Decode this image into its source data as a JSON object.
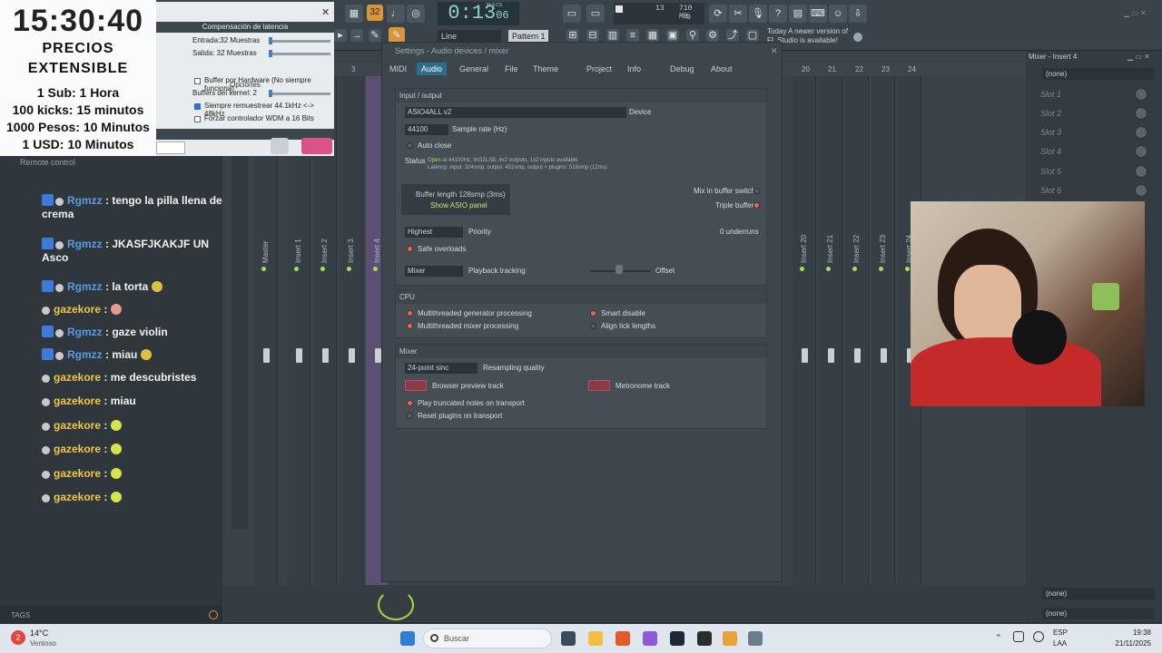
{
  "overlay": {
    "clock": "15:30:40",
    "title1": "PRECIOS",
    "title2": "EXTENSIBLE",
    "lines": [
      "1 Sub: 1 Hora",
      "100 kicks: 15 minutos",
      "1000 Pesos: 10 Minutos",
      "1 USD: 10 Minutos"
    ]
  },
  "toolbar": {
    "tempo": "32",
    "time": "0:13",
    "time_small": "06",
    "time_unit": "M:S:CS",
    "cpu_value": "13",
    "ram_value": "710 MB",
    "poly_value": "0",
    "line_label": "Line",
    "pattern_label": "Pattern 1",
    "news_line1": "Today  A newer version of",
    "news_line2": "FL Studio is available!"
  },
  "latency": {
    "header": "Compensación de latencia",
    "entrada": "Entrada:32 Muestras",
    "salida": "Salida:  32 Muestras",
    "opciones": "Opciones",
    "buffer_hw": "Buffer por Hardware (No siempre funciona)",
    "buffers_kernel": "Buffers del kernel: 2",
    "remuestrear": "Siempre remuestrear 44.1kHz <-> 48kHz",
    "forzar": "Forzar controlador WDM a 16 Bits"
  },
  "chat": {
    "remote": "Remote control",
    "messages": [
      {
        "user": "Rgmzz",
        "text": ": tengo la pilla llena de crema"
      },
      {
        "user": "Rgmzz",
        "text": ": JKASFJKAKJF UN Asco"
      },
      {
        "user": "Rgmzz",
        "text": ": la torta"
      },
      {
        "user": "gazekore",
        "text": ":"
      },
      {
        "user": "Rgmzz",
        "text": ": gaze violin"
      },
      {
        "user": "Rgmzz",
        "text": ": miau"
      },
      {
        "user": "gazekore",
        "text": ": me descubristes"
      },
      {
        "user": "gazekore",
        "text": ": miau"
      },
      {
        "user": "gazekore",
        "text": ":"
      },
      {
        "user": "gazekore",
        "text": ":"
      },
      {
        "user": "gazekore",
        "text": ":"
      },
      {
        "user": "gazekore",
        "text": ":"
      }
    ],
    "tags": "TAGS"
  },
  "mixer": {
    "strips": [
      "Master",
      "Insert 1",
      "Insert 2",
      "Insert 3",
      "Insert 4",
      "Insert 20",
      "Insert 21",
      "Insert 22",
      "Insert 23",
      "Insert 24"
    ],
    "numbers": [
      "3",
      "20",
      "21",
      "22",
      "23",
      "24"
    ]
  },
  "settings": {
    "title": "Settings - Audio devices / mixer",
    "tabs": [
      "MIDI",
      "Audio",
      "General",
      "File",
      "Theme",
      "Project",
      "Info",
      "Debug",
      "About"
    ],
    "io_header": "Input / output",
    "device_value": "ASIO4ALL v2",
    "device_label": "Device",
    "rate_value": "44100",
    "rate_label": "Sample rate (Hz)",
    "auto_close": "Auto close",
    "status_label": "Status",
    "status_open": "Open",
    "status_line1": "at 44100Hz, Int32LSB, 4x2 outputs, 1x2 inputs available",
    "status_line2": "Latency: input: 324smp, output: 452smp, output + plugins: 516smp (12ms)",
    "buffer_length": "Buffer length 128smp (3ms)",
    "show_asio": "Show ASIO panel",
    "mix_buffer": "Mix in buffer switch",
    "triple_buffer": "Triple buffer",
    "priority_value": "Highest",
    "priority_label": "Priority",
    "underruns": "0 underruns",
    "safe_overloads": "Safe overloads",
    "playback_value": "Mixer",
    "playback_label": "Playback tracking",
    "offset_label": "Offset",
    "cpu_header": "CPU",
    "mt_gen": "Multithreaded generator processing",
    "mt_mix": "Multithreaded mixer processing",
    "smart_disable": "Smart disable",
    "align_tick": "Align tick lengths",
    "mixer_header": "Mixer",
    "resampling_value": "24-point sinc",
    "resampling_label": "Resampling quality",
    "browser_preview": "Browser preview track",
    "metronome": "Metronome track",
    "play_truncated": "Play truncated notes on transport",
    "reset_plugins": "Reset plugins on transport"
  },
  "right_panel": {
    "title": "Mixer - Insert 4",
    "none": "(none)",
    "slots": [
      "Slot 1",
      "Slot 2",
      "Slot 3",
      "Slot 4",
      "Slot 5",
      "Slot 6"
    ]
  },
  "taskbar": {
    "temp": "14°C",
    "weather": "Ventoso",
    "search": "Buscar",
    "lang1": "ESP",
    "lang2": "LAA",
    "clock_time": "19:38",
    "clock_date": "21/11/2025",
    "badge": "2"
  },
  "colors": {
    "accent": "#2f6b8a",
    "led_on": "#e06a5a",
    "green_led": "#9ee05a",
    "insert_highlight": "#5b4f73"
  }
}
